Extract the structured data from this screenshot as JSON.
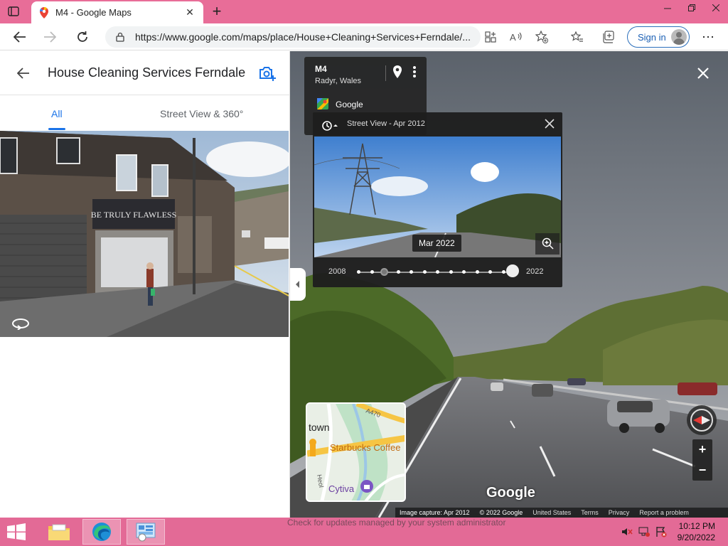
{
  "browser": {
    "tab_title": "M4 - Google Maps",
    "tab_close": "✕",
    "new_tab": "+",
    "url": "https://www.google.com/maps/place/House+Cleaning+Services+Ferndale/...",
    "signin_label": "Sign in",
    "more_label": "⋯"
  },
  "left_panel": {
    "title": "House Cleaning Services Ferndale",
    "tabs": [
      {
        "label": "All",
        "active": true
      },
      {
        "label": "Street View & 360°",
        "active": false
      }
    ],
    "shop_sign": "BE TRULY FLAWLESS"
  },
  "info_card": {
    "title": "M4",
    "subtitle": "Radyr, Wales",
    "brand": "Google"
  },
  "time_machine": {
    "label": "Street View - Apr 2012",
    "selected_date": "Mar 2022",
    "start_year": "2008",
    "end_year": "2022",
    "dot_count": 12,
    "selected_index": 2
  },
  "minimap": {
    "labels": [
      "town",
      "Starbucks Coffee",
      "Cytiva",
      "A470",
      "Heol"
    ]
  },
  "street_view": {
    "watermark": "Google",
    "footer": {
      "capture": "Image capture: Apr 2012",
      "copyright": "© 2022 Google",
      "links": [
        "United States",
        "Terms",
        "Privacy",
        "Report a problem"
      ]
    }
  },
  "taskbar": {
    "notice": "Check for updates managed by your system administrator",
    "time": "10:12 PM",
    "date": "9/20/2022"
  },
  "colors": {
    "chrome_accent": "#e86d98",
    "link_blue": "#1a73e8",
    "taskbar": "#e36a96"
  }
}
